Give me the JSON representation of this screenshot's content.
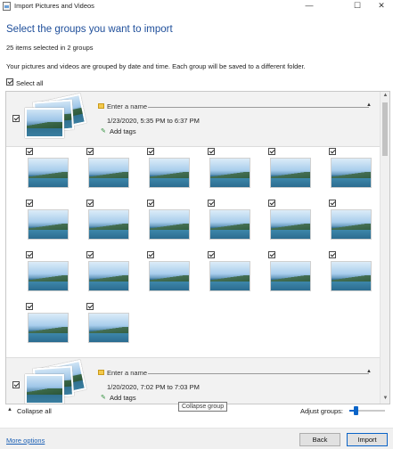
{
  "window": {
    "title": "Import Pictures and Videos",
    "minimize_glyph": "—",
    "maximize_glyph": "☐",
    "close_glyph": "✕"
  },
  "heading": "Select the groups you want to import",
  "selected_count": "25 items selected in 2 groups",
  "description": "Your pictures and videos are grouped by date and time. Each group will be saved to a different folder.",
  "select_all": {
    "label": "Select all",
    "checked": true
  },
  "groups": [
    {
      "checked": true,
      "name_placeholder": "Enter a name",
      "date_range": "1/23/2020, 5:35 PM to 6:37 PM",
      "add_tags": "Add tags",
      "expanded": true,
      "item_count": 20
    },
    {
      "checked": true,
      "name_placeholder": "Enter a name",
      "date_range": "1/20/2020, 7:02 PM to 7:03 PM",
      "add_tags": "Add tags",
      "expanded": false
    }
  ],
  "collapse_all": "Collapse all",
  "tooltip": "Collapse group",
  "adjust_groups": {
    "label": "Adjust groups:",
    "level": 0.15
  },
  "footer": {
    "more_options": "More options",
    "back_label": "Back",
    "import_label": "Import"
  },
  "icons": {
    "folder": "folder-icon",
    "tag": "tag-icon",
    "collapse": "chevron-up-icon"
  },
  "colors": {
    "heading": "#1e4e9a",
    "accent": "#0a64c8",
    "link": "#1a5fb4"
  }
}
